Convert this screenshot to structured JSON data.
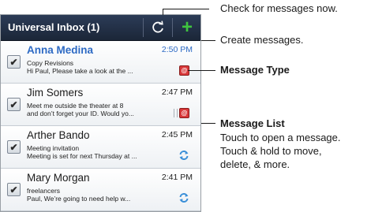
{
  "inbox": {
    "title": "Universal Inbox (1)",
    "refresh_icon": "refresh-icon",
    "compose_icon": "plus-icon"
  },
  "messages": [
    {
      "name": "Anna Medina",
      "time": "2:50 PM",
      "line1": "Copy Revisions",
      "line2": "Hi Paul, Please take a look at the ...",
      "unread": true,
      "type_icon": "email-icon",
      "type_glyph": "@"
    },
    {
      "name": "Jim Somers",
      "time": "2:47 PM",
      "line1": "Meet me outside the theater at 8",
      "line2": "and don’t forget your ID. Would yo...",
      "unread": false,
      "type_icon": "email-icon",
      "type_glyph": "@"
    },
    {
      "name": "Arther Bando",
      "time": "2:45 PM",
      "line1": "Meeting invitation",
      "line2": "Meeting is set for next Thursday at ...",
      "unread": false,
      "type_icon": "sync-icon"
    },
    {
      "name": "Mary Morgan",
      "time": "2:41 PM",
      "line1": "freelancers",
      "line2": "Paul, We’re going to need help w...",
      "unread": false,
      "type_icon": "sync-icon"
    }
  ],
  "callouts": {
    "check": "Check for messages now.",
    "create": "Create messages.",
    "message_type": "Message Type",
    "message_list": "Message List",
    "list_line1": "Touch to open a message.",
    "list_line2": "Touch & hold to move,",
    "list_line3": "delete, & more."
  },
  "colors": {
    "title_bar": "#1f2b40",
    "unread_accent": "#2d6ac4",
    "compose_green": "#3fc43f",
    "email_badge": "#d9383a"
  }
}
